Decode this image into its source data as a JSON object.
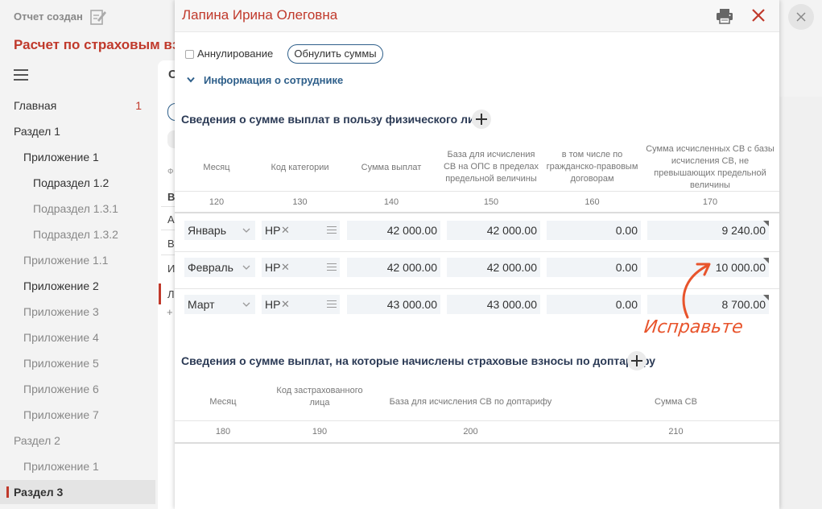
{
  "header": {
    "report_status": "Отчет создан",
    "page_title": "Расчет по страховым взносам"
  },
  "sidebar": {
    "items": [
      {
        "label": "Главная",
        "badge": "1"
      },
      {
        "label": "Раздел 1"
      },
      {
        "label": "Приложение 1"
      },
      {
        "label": "Подраздел 1.2"
      },
      {
        "label": "Подраздел 1.3.1"
      },
      {
        "label": "Подраздел 1.3.2"
      },
      {
        "label": "Приложение 1.1"
      },
      {
        "label": "Приложение 2"
      },
      {
        "label": "Приложение 3"
      },
      {
        "label": "Приложение 4"
      },
      {
        "label": "Приложение 5"
      },
      {
        "label": "Приложение 6"
      },
      {
        "label": "Приложение 7"
      },
      {
        "label": "Раздел 2"
      },
      {
        "label": "Приложение 1"
      },
      {
        "label": "Раздел 3"
      }
    ]
  },
  "background_fragments": [
    "С",
    "Ф",
    "В",
    "А",
    "В",
    "И",
    "Л",
    "+"
  ],
  "modal": {
    "title": "Лапина Ирина Олеговна",
    "annul_label": "Аннулирование",
    "zero_button": "Обнулить суммы",
    "info_toggle": "Информация о сотруднике",
    "section1": {
      "title": "Сведения о сумме выплат в пользу физического лица",
      "headers": [
        {
          "label": "Месяц",
          "code": "120"
        },
        {
          "label": "Код категории",
          "code": "130"
        },
        {
          "label": "Сумма выплат",
          "code": "140"
        },
        {
          "label": "База для исчисления СВ на ОПС в пределах предельной величины",
          "code": "150"
        },
        {
          "label": "в том числе по гражданско-правовым договорам",
          "code": "160"
        },
        {
          "label": "Сумма исчисленных СВ с базы исчисления СВ, не превышающих предельной величины",
          "code": "170"
        }
      ],
      "rows": [
        {
          "month": "Январь",
          "code": "НР",
          "sum": "42 000.00",
          "base": "42 000.00",
          "gpd": "0.00",
          "insurance": "9 240.00"
        },
        {
          "month": "Февраль",
          "code": "НР",
          "sum": "42 000.00",
          "base": "42 000.00",
          "gpd": "0.00",
          "insurance": "10 000.00"
        },
        {
          "month": "Март",
          "code": "НР",
          "sum": "43 000.00",
          "base": "43 000.00",
          "gpd": "0.00",
          "insurance": "8 700.00"
        }
      ]
    },
    "section2": {
      "title": "Сведения о сумме выплат, на которые начислены страховые взносы по доптарифу",
      "headers": [
        {
          "label": "Месяц",
          "code": "180"
        },
        {
          "label": "Код застрахованного лица",
          "code": "190"
        },
        {
          "label": "База для исчисления СВ по доптарифу",
          "code": "200"
        },
        {
          "label": "Сумма СВ",
          "code": "210"
        }
      ]
    }
  },
  "annotation": "Исправьте",
  "colors": {
    "accent": "#c0392b",
    "link": "#2e5f8a",
    "annotation": "#e8542c"
  }
}
